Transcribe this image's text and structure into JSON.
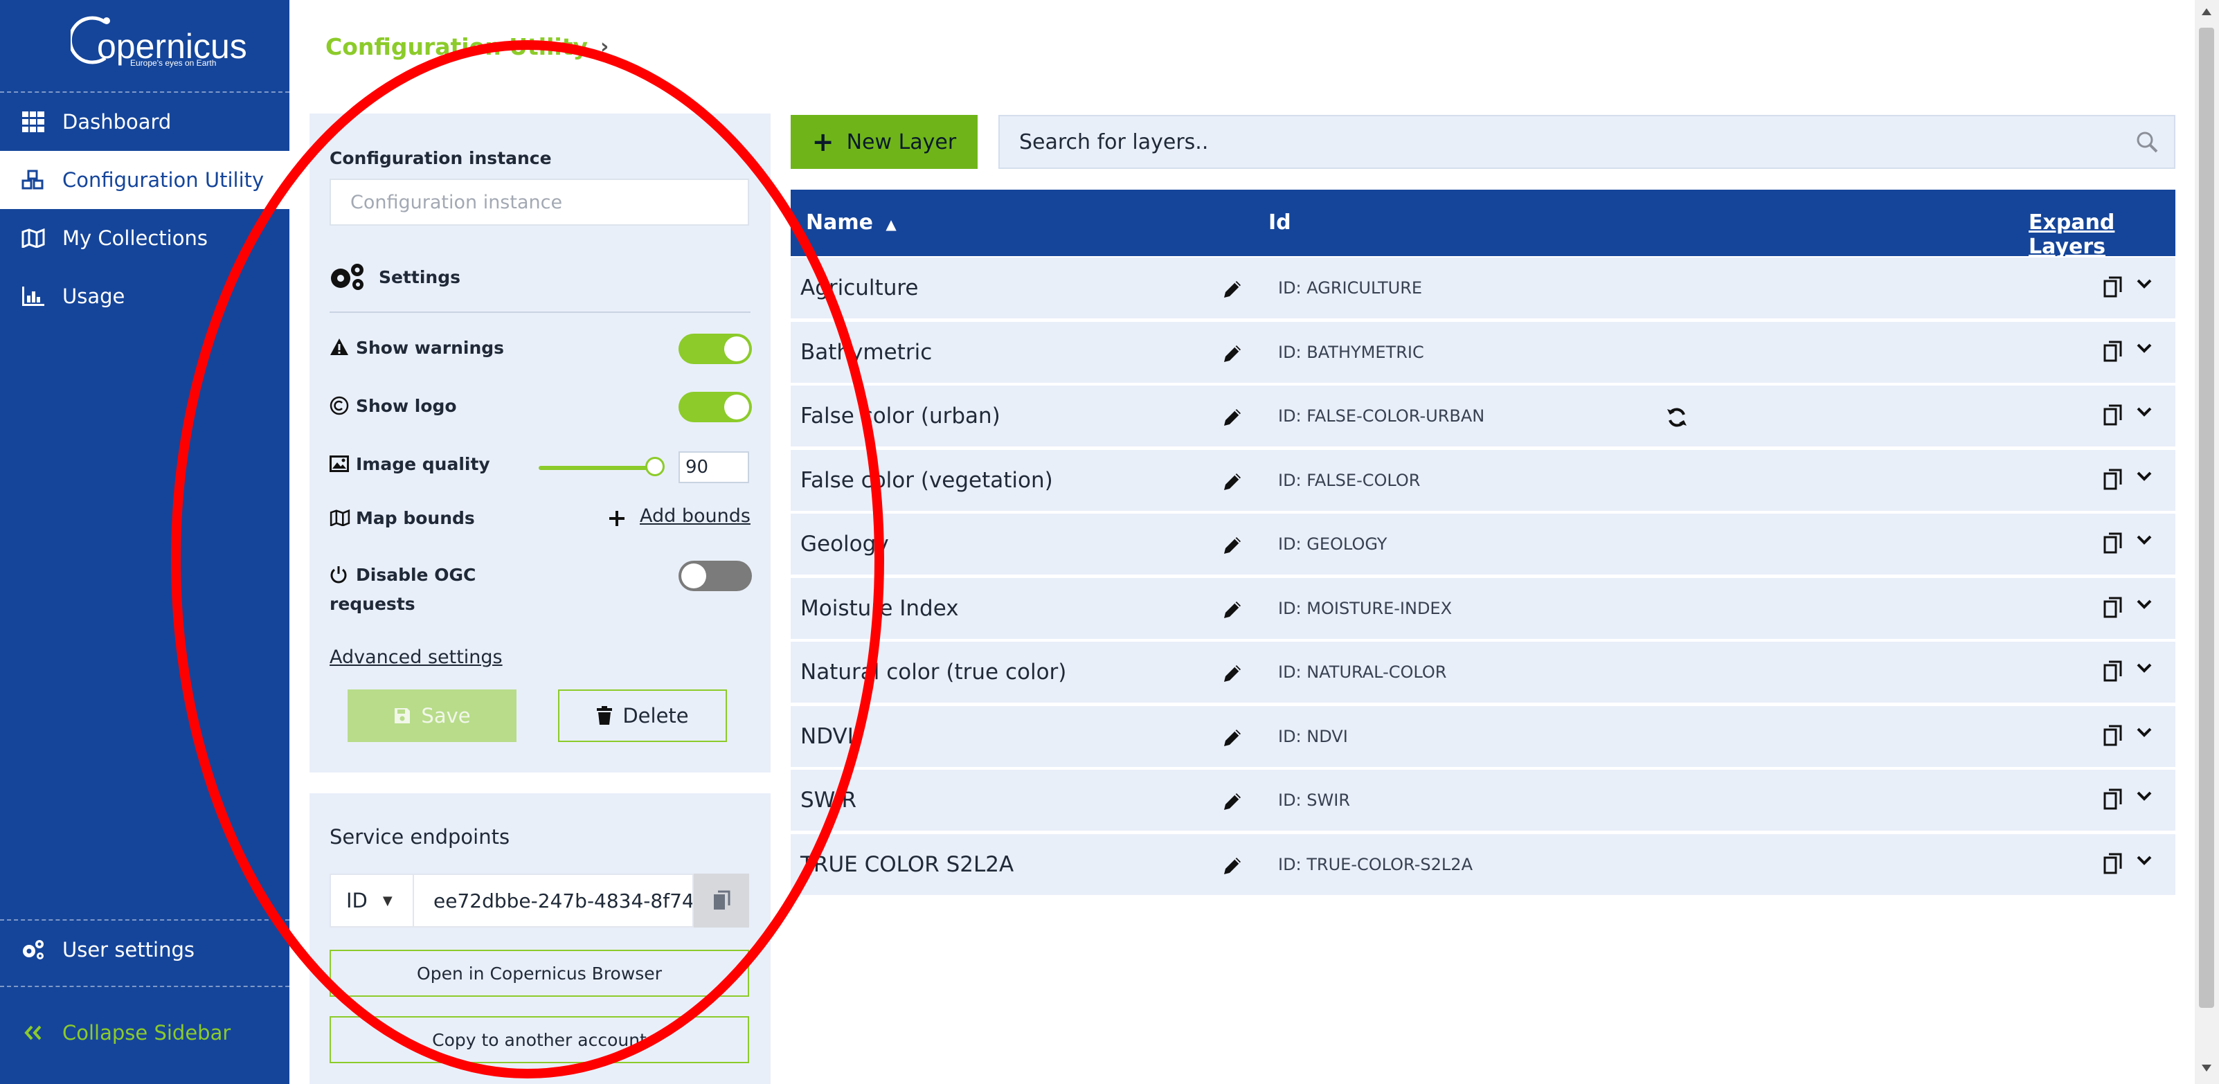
{
  "sidebar": {
    "logo": {
      "word": "opernicus",
      "tagline": "Europe's eyes on Earth"
    },
    "items": [
      {
        "label": "Dashboard",
        "icon": "grid-icon"
      },
      {
        "label": "Configuration Utility",
        "icon": "cubes-icon",
        "active": true
      },
      {
        "label": "My Collections",
        "icon": "map-icon"
      },
      {
        "label": "Usage",
        "icon": "bar-chart-icon"
      }
    ],
    "user_settings": "User settings",
    "collapse": "Collapse Sidebar"
  },
  "breadcrumb": {
    "label": "Configuration Utility"
  },
  "config": {
    "instance_label": "Configuration instance",
    "instance_placeholder": "Configuration instance",
    "settings_label": "Settings",
    "show_warnings": {
      "label": "Show warnings",
      "on": true
    },
    "show_logo": {
      "label": "Show logo",
      "on": true
    },
    "image_quality": {
      "label": "Image quality",
      "value": "90"
    },
    "map_bounds": {
      "label": "Map bounds",
      "action": "Add bounds"
    },
    "disable_ogc": {
      "label_line1": "Disable OGC",
      "label_line2": "requests",
      "on": false
    },
    "advanced": "Advanced settings",
    "save": "Save",
    "delete": "Delete"
  },
  "endpoints": {
    "title": "Service endpoints",
    "type": "ID",
    "value": "ee72dbbe-247b-4834-8f74",
    "open_browser": "Open in Copernicus Browser",
    "copy_account": "Copy to another account"
  },
  "layers": {
    "new_layer": "New Layer",
    "search_placeholder": "Search for layers..",
    "headers": {
      "name": "Name",
      "id": "Id",
      "expand": "Expand Layers"
    },
    "rows": [
      {
        "name": "Agriculture",
        "id": "ID: AGRICULTURE"
      },
      {
        "name": "Bathymetric",
        "id": "ID: BATHYMETRIC"
      },
      {
        "name": "False color (urban)",
        "id": "ID: FALSE-COLOR-URBAN"
      },
      {
        "name": "False color (vegetation)",
        "id": "ID: FALSE-COLOR"
      },
      {
        "name": "Geology",
        "id": "ID: GEOLOGY"
      },
      {
        "name": "Moisture Index",
        "id": "ID: MOISTURE-INDEX"
      },
      {
        "name": "Natural color (true color)",
        "id": "ID: NATURAL-COLOR"
      },
      {
        "name": "NDVI",
        "id": "ID: NDVI"
      },
      {
        "name": "SWIR",
        "id": "ID: SWIR"
      },
      {
        "name": "TRUE COLOR S2L2A",
        "id": "ID: TRUE-COLOR-S2L2A"
      }
    ]
  },
  "colors": {
    "sidebar": "#15459a",
    "accent_green": "#8ccb2a",
    "panel": "#e9eff9",
    "annotation_red": "#ff0000"
  }
}
